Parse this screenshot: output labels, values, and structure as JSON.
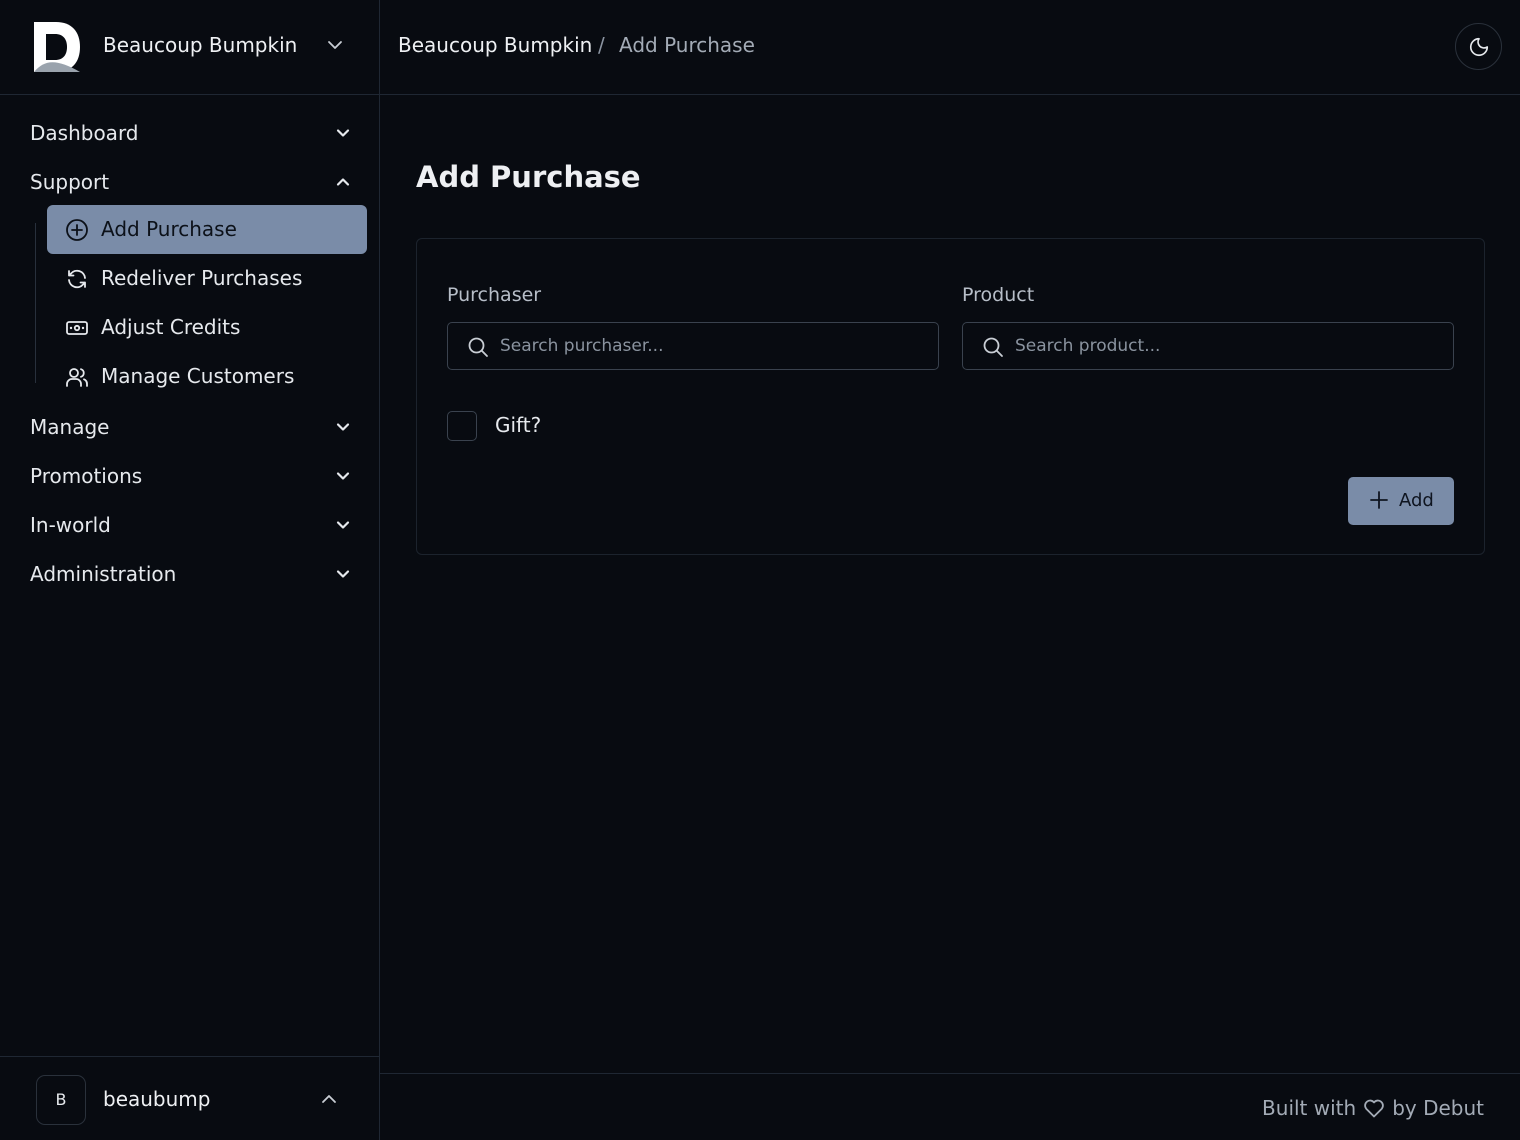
{
  "brand": {
    "name": "Beaucoup Bumpkin",
    "logo_icon": "debut-logo-icon"
  },
  "nav": {
    "groups_top": [
      {
        "label": "Dashboard",
        "expanded": false
      },
      {
        "label": "Support",
        "expanded": true
      }
    ],
    "support_items": [
      {
        "label": "Add Purchase",
        "icon": "plus-circle-icon",
        "active": true
      },
      {
        "label": "Redeliver Purchases",
        "icon": "refresh-icon",
        "active": false
      },
      {
        "label": "Adjust Credits",
        "icon": "banknote-icon",
        "active": false
      },
      {
        "label": "Manage Customers",
        "icon": "users-icon",
        "active": false
      }
    ],
    "groups_bottom": [
      {
        "label": "Manage",
        "expanded": false
      },
      {
        "label": "Promotions",
        "expanded": false
      },
      {
        "label": "In-world",
        "expanded": false
      },
      {
        "label": "Administration",
        "expanded": false
      }
    ]
  },
  "user": {
    "initial": "B",
    "name": "beaubump"
  },
  "header": {
    "breadcrumb_root": "Beaucoup Bumpkin",
    "breadcrumb_sep": "/",
    "breadcrumb_current": "Add Purchase",
    "theme_icon": "moon-icon"
  },
  "main": {
    "title": "Add Purchase",
    "purchaser": {
      "label": "Purchaser",
      "placeholder": "Search purchaser...",
      "value": ""
    },
    "product": {
      "label": "Product",
      "placeholder": "Search product...",
      "value": ""
    },
    "gift": {
      "label": "Gift?",
      "checked": false
    },
    "add_button": "Add"
  },
  "footer": {
    "built_with": "Built with",
    "by": "by Debut"
  },
  "colors": {
    "background": "#080b11",
    "border": "#1f2733",
    "accent": "#7a8ca8",
    "text": "#e6e9ed",
    "muted": "#a3abb6"
  }
}
